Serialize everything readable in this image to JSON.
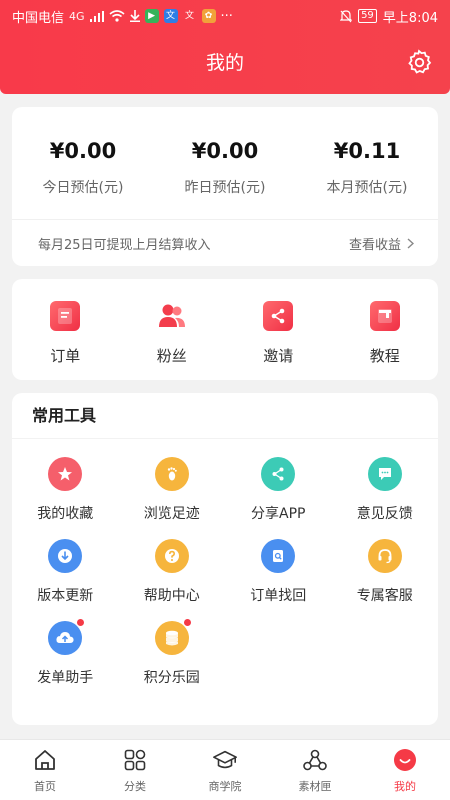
{
  "status_bar": {
    "carrier": "中国电信",
    "signal": "4G",
    "time": "早上8:04",
    "battery": "59",
    "more": "···"
  },
  "header": {
    "title": "我的",
    "settings_icon": "gear-icon"
  },
  "earnings": {
    "items": [
      {
        "value": "¥0.00",
        "label": "今日预估(元)"
      },
      {
        "value": "¥0.00",
        "label": "昨日预估(元)"
      },
      {
        "value": "¥0.11",
        "label": "本月预估(元)"
      }
    ],
    "notice": "每月25日可提现上月结算收入",
    "link": "查看收益"
  },
  "quick_actions": [
    {
      "label": "订单",
      "icon": "order-icon"
    },
    {
      "label": "粉丝",
      "icon": "fans-icon"
    },
    {
      "label": "邀请",
      "icon": "share-icon"
    },
    {
      "label": "教程",
      "icon": "tutorial-icon"
    }
  ],
  "tools": {
    "title": "常用工具",
    "items": [
      {
        "label": "我的收藏",
        "icon": "star-icon",
        "color": "#f55f6b"
      },
      {
        "label": "浏览足迹",
        "icon": "footprint-icon",
        "color": "#f6b53d"
      },
      {
        "label": "分享APP",
        "icon": "share-icon",
        "color": "#3ccbb6"
      },
      {
        "label": "意见反馈",
        "icon": "chat-icon",
        "color": "#3ccbb6"
      },
      {
        "label": "版本更新",
        "icon": "download-icon",
        "color": "#4a8ff0"
      },
      {
        "label": "帮助中心",
        "icon": "question-icon",
        "color": "#f6b53d"
      },
      {
        "label": "订单找回",
        "icon": "search-doc-icon",
        "color": "#4a8ff0"
      },
      {
        "label": "专属客服",
        "icon": "headset-icon",
        "color": "#f6b53d"
      },
      {
        "label": "发单助手",
        "icon": "cloud-upload-icon",
        "color": "#4a8ff0"
      },
      {
        "label": "积分乐园",
        "icon": "coins-icon",
        "color": "#f6b53d"
      }
    ]
  },
  "tabbar": {
    "items": [
      {
        "label": "首页",
        "icon": "home-icon"
      },
      {
        "label": "分类",
        "icon": "grid-icon"
      },
      {
        "label": "商学院",
        "icon": "graduation-cap-icon"
      },
      {
        "label": "素材匣",
        "icon": "material-icon"
      },
      {
        "label": "我的",
        "icon": "profile-icon"
      }
    ],
    "active": "我的"
  },
  "colors": {
    "brand": "#f53a46",
    "background": "#f2f2f2"
  }
}
